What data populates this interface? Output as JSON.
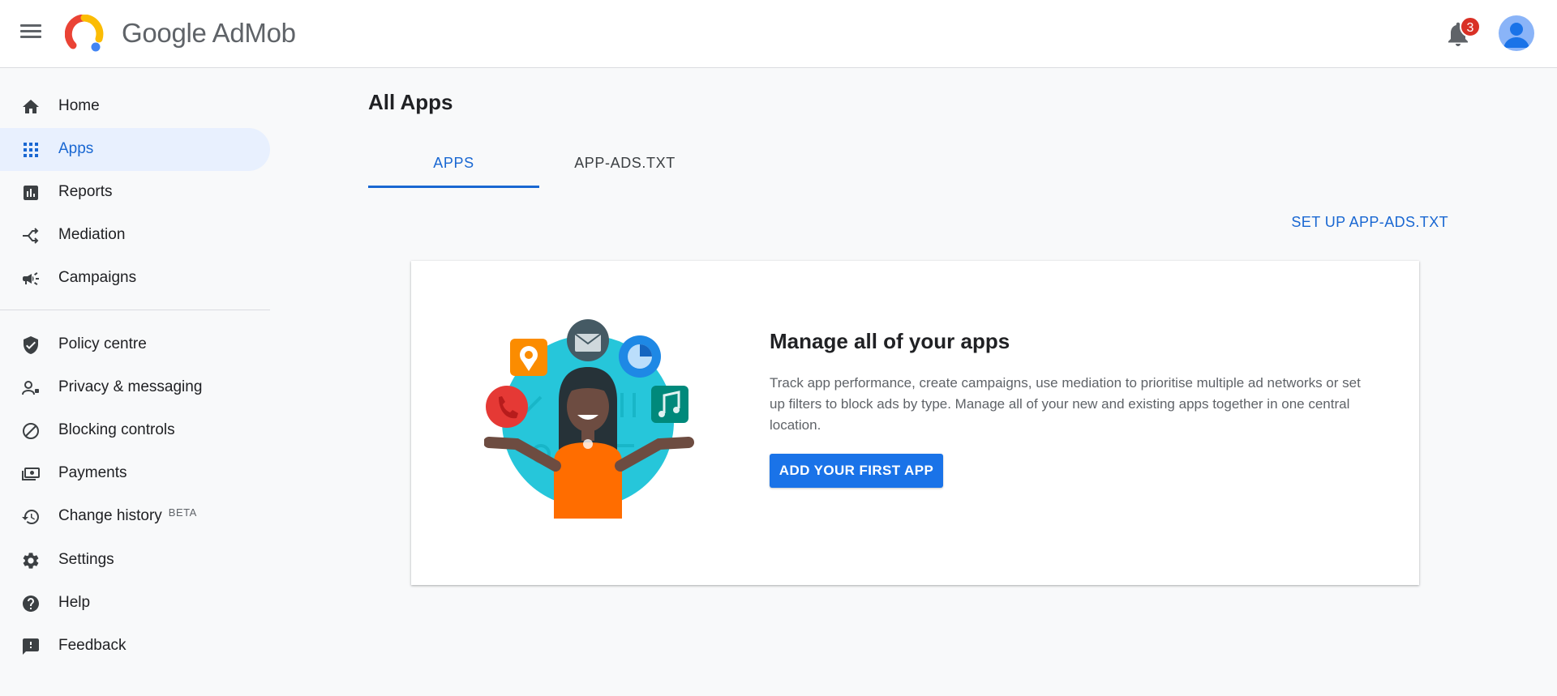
{
  "header": {
    "product_name": "Google AdMob",
    "notification_count": "3",
    "icons": [
      "menu-icon",
      "admob-logo",
      "bell-icon",
      "account-icon"
    ]
  },
  "sidebar": {
    "items": [
      {
        "label": "Home",
        "icon": "home-icon"
      },
      {
        "label": "Apps",
        "icon": "apps-grid-icon",
        "active": true
      },
      {
        "label": "Reports",
        "icon": "bar-chart-icon"
      },
      {
        "label": "Mediation",
        "icon": "mediation-icon"
      },
      {
        "label": "Campaigns",
        "icon": "megaphone-icon"
      },
      {
        "label": "Policy centre",
        "icon": "shield-check-icon"
      },
      {
        "label": "Privacy & messaging",
        "icon": "person-privacy-icon"
      },
      {
        "label": "Blocking controls",
        "icon": "block-icon"
      },
      {
        "label": "Payments",
        "icon": "payments-icon"
      },
      {
        "label": "Change history",
        "badge": "BETA",
        "icon": "history-icon"
      },
      {
        "label": "Settings",
        "icon": "gear-icon"
      },
      {
        "label": "Help",
        "icon": "help-icon"
      },
      {
        "label": "Feedback",
        "icon": "feedback-icon"
      }
    ]
  },
  "main": {
    "title": "All Apps",
    "tabs": [
      {
        "label": "APPS",
        "active": true
      },
      {
        "label": "APP-ADS.TXT"
      }
    ],
    "setup_link": "SET UP APP-ADS.TXT",
    "card": {
      "title": "Manage all of your apps",
      "description": "Track app performance, create campaigns, use mediation to prioritise multiple ad networks or set up filters to block ads by type. Manage all of your new and existing apps together in one central location.",
      "cta_label": "ADD YOUR FIRST APP"
    }
  },
  "colors": {
    "accent": "#1967d2",
    "button": "#1a73e8",
    "active_nav_bg": "#e8f0fe",
    "badge": "#d93025",
    "page_bg": "#f8f9fa"
  }
}
